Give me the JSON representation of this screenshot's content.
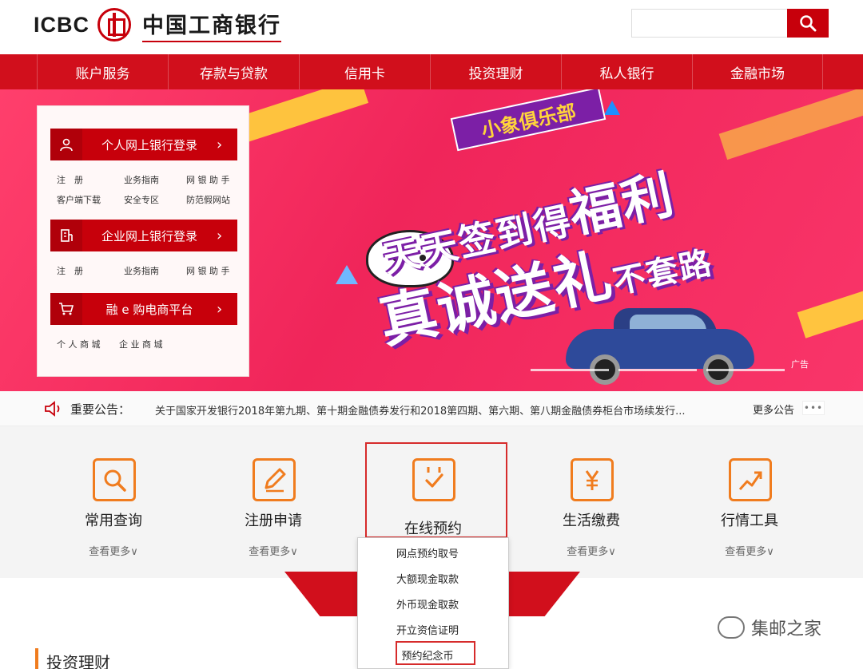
{
  "header": {
    "logo_en": "ICBC",
    "logo_cn": "中国工商银行",
    "search_placeholder": "",
    "accent_color": "#c7000b"
  },
  "nav": {
    "items": [
      "账户服务",
      "存款与贷款",
      "信用卡",
      "投资理财",
      "私人银行",
      "金融市场"
    ]
  },
  "banner": {
    "club": "小象俱乐部",
    "slogan_line1_prefix": "天天签到得",
    "slogan_line1_big": "福利",
    "slogan_line2_big": "真诚送礼",
    "slogan_line2_small": "不套路",
    "ad_tag": "广告"
  },
  "login_panel": {
    "personal": {
      "label": "个人网上银行登录",
      "links": [
        "注　册",
        "业务指南",
        "网 银 助 手",
        "客户端下载",
        "安全专区",
        "防范假网站"
      ]
    },
    "corporate": {
      "label": "企业网上银行登录",
      "links": [
        "注　册",
        "业务指南",
        "网 银 助 手"
      ]
    },
    "ecommerce": {
      "label": "融 e 购电商平台",
      "links": [
        "个 人 商 城",
        "企 业 商 城"
      ]
    }
  },
  "notice": {
    "title": "重要公告：",
    "text": "关于国家开发银行2018年第九期、第十期金融债券发行和2018第四期、第六期、第八期金融债券柜台市场续发行...",
    "more": "更多公告",
    "dots": "•••"
  },
  "services": [
    {
      "label": "常用查询",
      "more": "查看更多∨",
      "icon": "search-doc-icon"
    },
    {
      "label": "注册申请",
      "more": "查看更多∨",
      "icon": "edit-icon"
    },
    {
      "label": "在线预约",
      "more": "",
      "icon": "calendar-check-icon"
    },
    {
      "label": "生活缴费",
      "more": "查看更多∨",
      "icon": "yen-icon"
    },
    {
      "label": "行情工具",
      "more": "查看更多∨",
      "icon": "trend-chart-icon"
    }
  ],
  "dropdown": {
    "items": [
      "网点预约取号",
      "大额现金取款",
      "外币现金取款",
      "开立资信证明",
      "预约纪念币"
    ]
  },
  "section": {
    "title": "投资理财"
  },
  "watermark": {
    "text": "集邮之家"
  }
}
